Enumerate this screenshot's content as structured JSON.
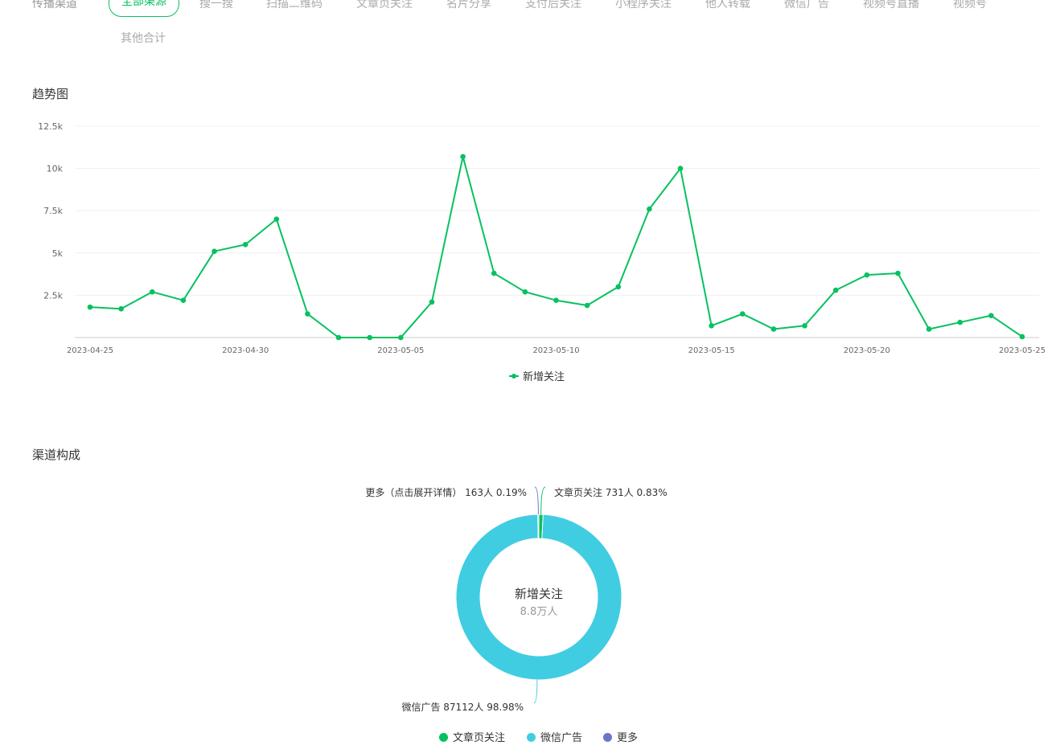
{
  "filter": {
    "label": "传播渠道",
    "chips": [
      "全部渠源",
      "搜一搜",
      "扫描二维码",
      "文章页关注",
      "名片分享",
      "支付后关注",
      "小程序关注",
      "他人转载",
      "微信广告",
      "视频号直播",
      "视频号",
      "其他合计"
    ],
    "active_index": 0
  },
  "trend": {
    "title": "趋势图",
    "y_tick_labels": [
      "2.5k",
      "5k",
      "7.5k",
      "10k",
      "12.5k"
    ],
    "x_tick_labels": [
      "2023-04-25",
      "2023-04-30",
      "2023-05-05",
      "2023-05-10",
      "2023-05-15",
      "2023-05-20",
      "2023-05-25"
    ],
    "legend_label": "新增关注",
    "line_color": "#07c160"
  },
  "chart_data": [
    {
      "type": "line",
      "title": "趋势图",
      "xlabel": "",
      "ylabel": "",
      "ylim": [
        0,
        12500
      ],
      "grid": true,
      "legend_position": "bottom",
      "x": [
        "2023-04-25",
        "2023-04-26",
        "2023-04-27",
        "2023-04-28",
        "2023-04-29",
        "2023-04-30",
        "2023-05-01",
        "2023-05-02",
        "2023-05-03",
        "2023-05-04",
        "2023-05-05",
        "2023-05-06",
        "2023-05-07",
        "2023-05-08",
        "2023-05-09",
        "2023-05-10",
        "2023-05-11",
        "2023-05-12",
        "2023-05-13",
        "2023-05-14",
        "2023-05-15",
        "2023-05-16",
        "2023-05-17",
        "2023-05-18",
        "2023-05-19",
        "2023-05-20",
        "2023-05-21",
        "2023-05-22",
        "2023-05-23",
        "2023-05-24",
        "2023-05-25"
      ],
      "series": [
        {
          "name": "新增关注",
          "values": [
            1800,
            1700,
            2700,
            2200,
            5100,
            5500,
            7000,
            1400,
            0,
            0,
            0,
            2100,
            10700,
            3800,
            2700,
            2200,
            1900,
            3000,
            7600,
            10000,
            700,
            1400,
            500,
            700,
            2800,
            3700,
            3800,
            500,
            900,
            1300,
            50
          ]
        }
      ]
    },
    {
      "type": "pie",
      "title": "渠道构成",
      "center_label": "新增关注",
      "center_value": "8.8万人",
      "legend_position": "bottom",
      "slices": [
        {
          "name": "文章页关注",
          "value": 731,
          "percent": 0.83,
          "color": "#07c160",
          "label": "文章页关注 731人 0.83%"
        },
        {
          "name": "微信广告",
          "value": 87112,
          "percent": 98.98,
          "color": "#40cde1",
          "label": "微信广告 87112人 98.98%"
        },
        {
          "name": "更多",
          "value": 163,
          "percent": 0.19,
          "color": "#6b76c9",
          "label": "更多（点击展开详情） 163人 0.19%"
        }
      ]
    }
  ],
  "composition": {
    "title": "渠道构成",
    "center_title": "新增关注",
    "center_value": "8.8万人",
    "legend": [
      "文章页关注",
      "微信广告",
      "更多"
    ]
  }
}
